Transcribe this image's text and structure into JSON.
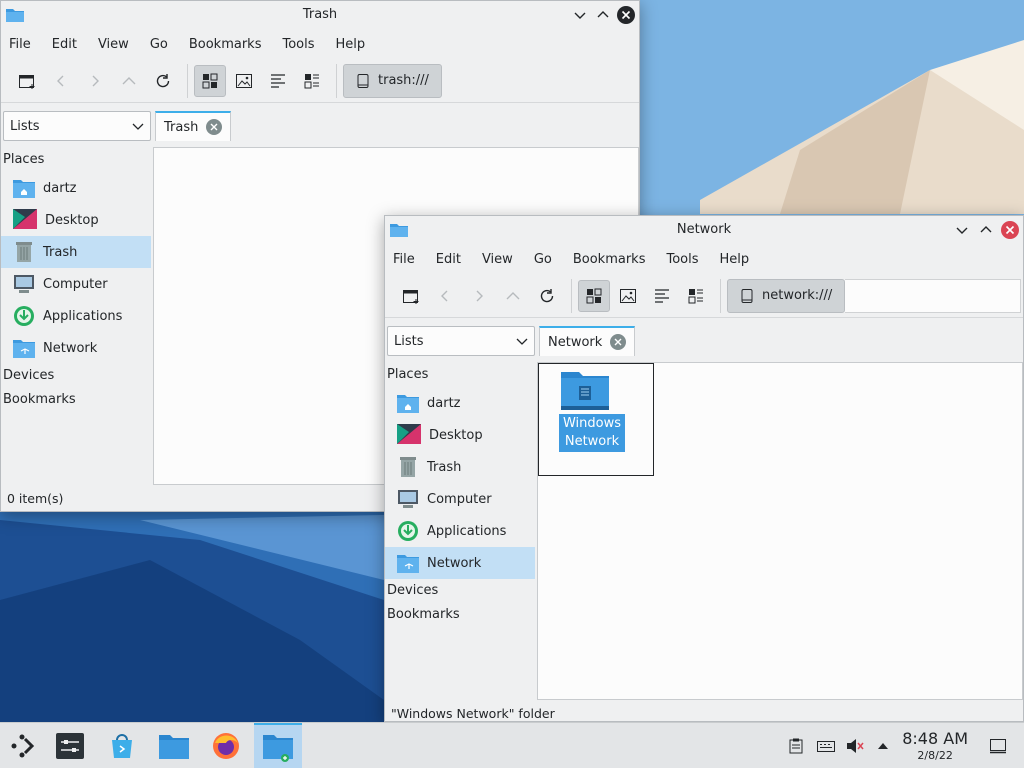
{
  "colors": {
    "accent": "#3daee9",
    "selection": "#c2dff5",
    "window_bg": "#eff0f1",
    "view_bg": "#fcfcfc",
    "folder": "#3d9ae0"
  },
  "trash_window": {
    "title": "Trash",
    "menu": [
      "File",
      "Edit",
      "View",
      "Go",
      "Bookmarks",
      "Tools",
      "Help"
    ],
    "location": "trash:///",
    "panel_combo": "Lists",
    "tab": "Trash",
    "places_heading": "Places",
    "places": [
      {
        "label": "dartz",
        "icon": "home-folder-icon"
      },
      {
        "label": "Desktop",
        "icon": "desktop-icon"
      },
      {
        "label": "Trash",
        "icon": "trash-icon",
        "selected": true
      },
      {
        "label": "Computer",
        "icon": "computer-icon"
      },
      {
        "label": "Applications",
        "icon": "applications-icon"
      },
      {
        "label": "Network",
        "icon": "network-folder-icon"
      }
    ],
    "devices_heading": "Devices",
    "bookmarks_heading": "Bookmarks",
    "status": "0 item(s)"
  },
  "network_window": {
    "title": "Network",
    "menu": [
      "File",
      "Edit",
      "View",
      "Go",
      "Bookmarks",
      "Tools",
      "Help"
    ],
    "location": "network:///",
    "panel_combo": "Lists",
    "tab": "Network",
    "places_heading": "Places",
    "places": [
      {
        "label": "dartz",
        "icon": "home-folder-icon"
      },
      {
        "label": "Desktop",
        "icon": "desktop-icon"
      },
      {
        "label": "Trash",
        "icon": "trash-icon"
      },
      {
        "label": "Computer",
        "icon": "computer-icon"
      },
      {
        "label": "Applications",
        "icon": "applications-icon"
      },
      {
        "label": "Network",
        "icon": "network-folder-icon",
        "selected": true
      }
    ],
    "devices_heading": "Devices",
    "bookmarks_heading": "Bookmarks",
    "files": [
      {
        "label_line1": "Windows",
        "label_line2": "Network"
      }
    ],
    "status": "\"Windows Network\" folder"
  },
  "taskbar": {
    "time": "8:48 AM",
    "date": "2/8/22"
  }
}
